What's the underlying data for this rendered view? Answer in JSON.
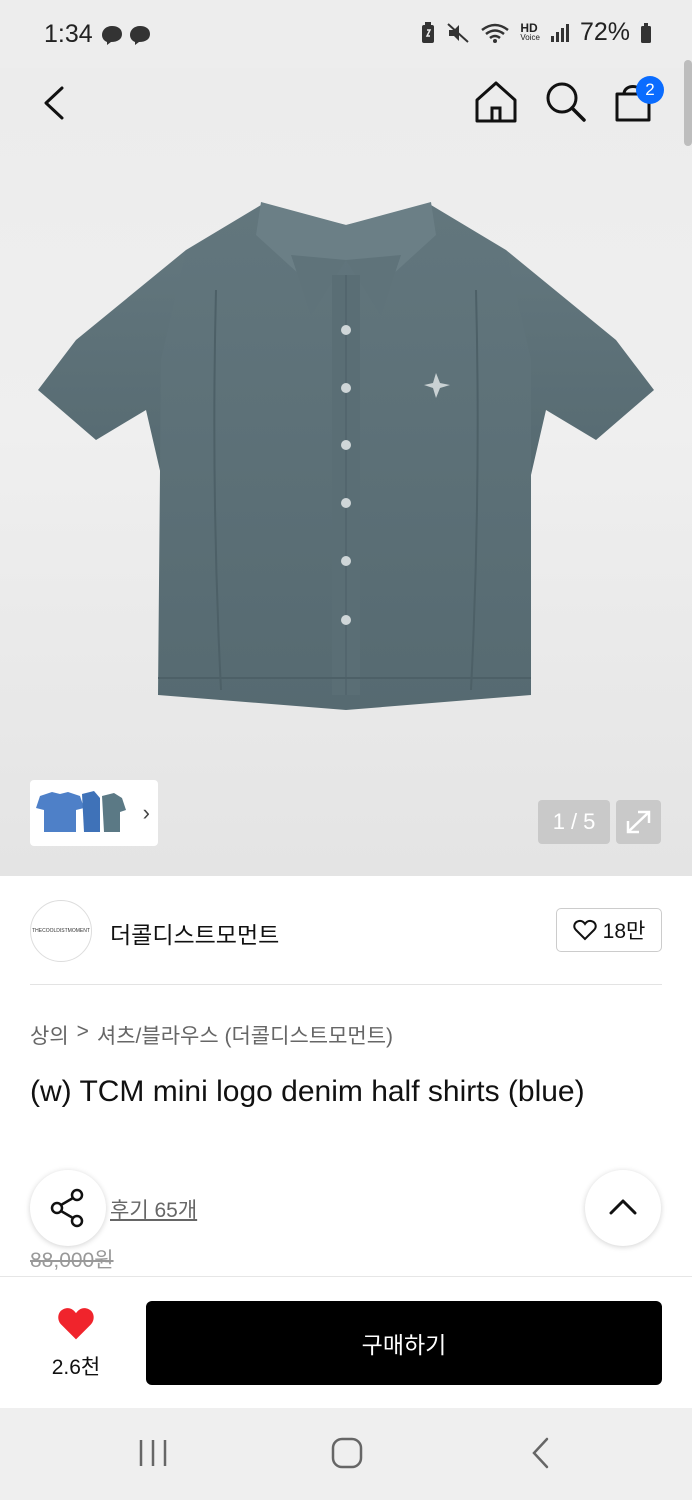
{
  "status_bar": {
    "time": "1:34",
    "battery": "72%",
    "icons": [
      "messenger-icon",
      "messenger-icon",
      "battery-saver-icon",
      "mute-icon",
      "wifi-icon",
      "hd-voice-icon",
      "signal-icon",
      "battery-icon"
    ],
    "hd_label": "HD",
    "voice_label": "Voice"
  },
  "header": {
    "cart_count": "2"
  },
  "gallery": {
    "page_current": "1",
    "page_separator": "/",
    "page_total": "5"
  },
  "brand": {
    "logo_text": "THECOOLDISTMOMENT",
    "name": "더콜디스트모먼트",
    "likes": "18만"
  },
  "breadcrumb": {
    "category": "상의",
    "separator": ">",
    "subcategory": "셔츠/블라우스 (더콜디스트모먼트)"
  },
  "product": {
    "title": "(w) TCM mini logo denim half shirts (blue)",
    "review_link": "후기 65개",
    "original_price": "88,000원"
  },
  "bottom_bar": {
    "wish_count": "2.6천",
    "buy_label": "구매하기"
  },
  "colors": {
    "accent_blue": "#0a6cff",
    "heart_red": "#f0242c",
    "denim": "#5b7078"
  }
}
